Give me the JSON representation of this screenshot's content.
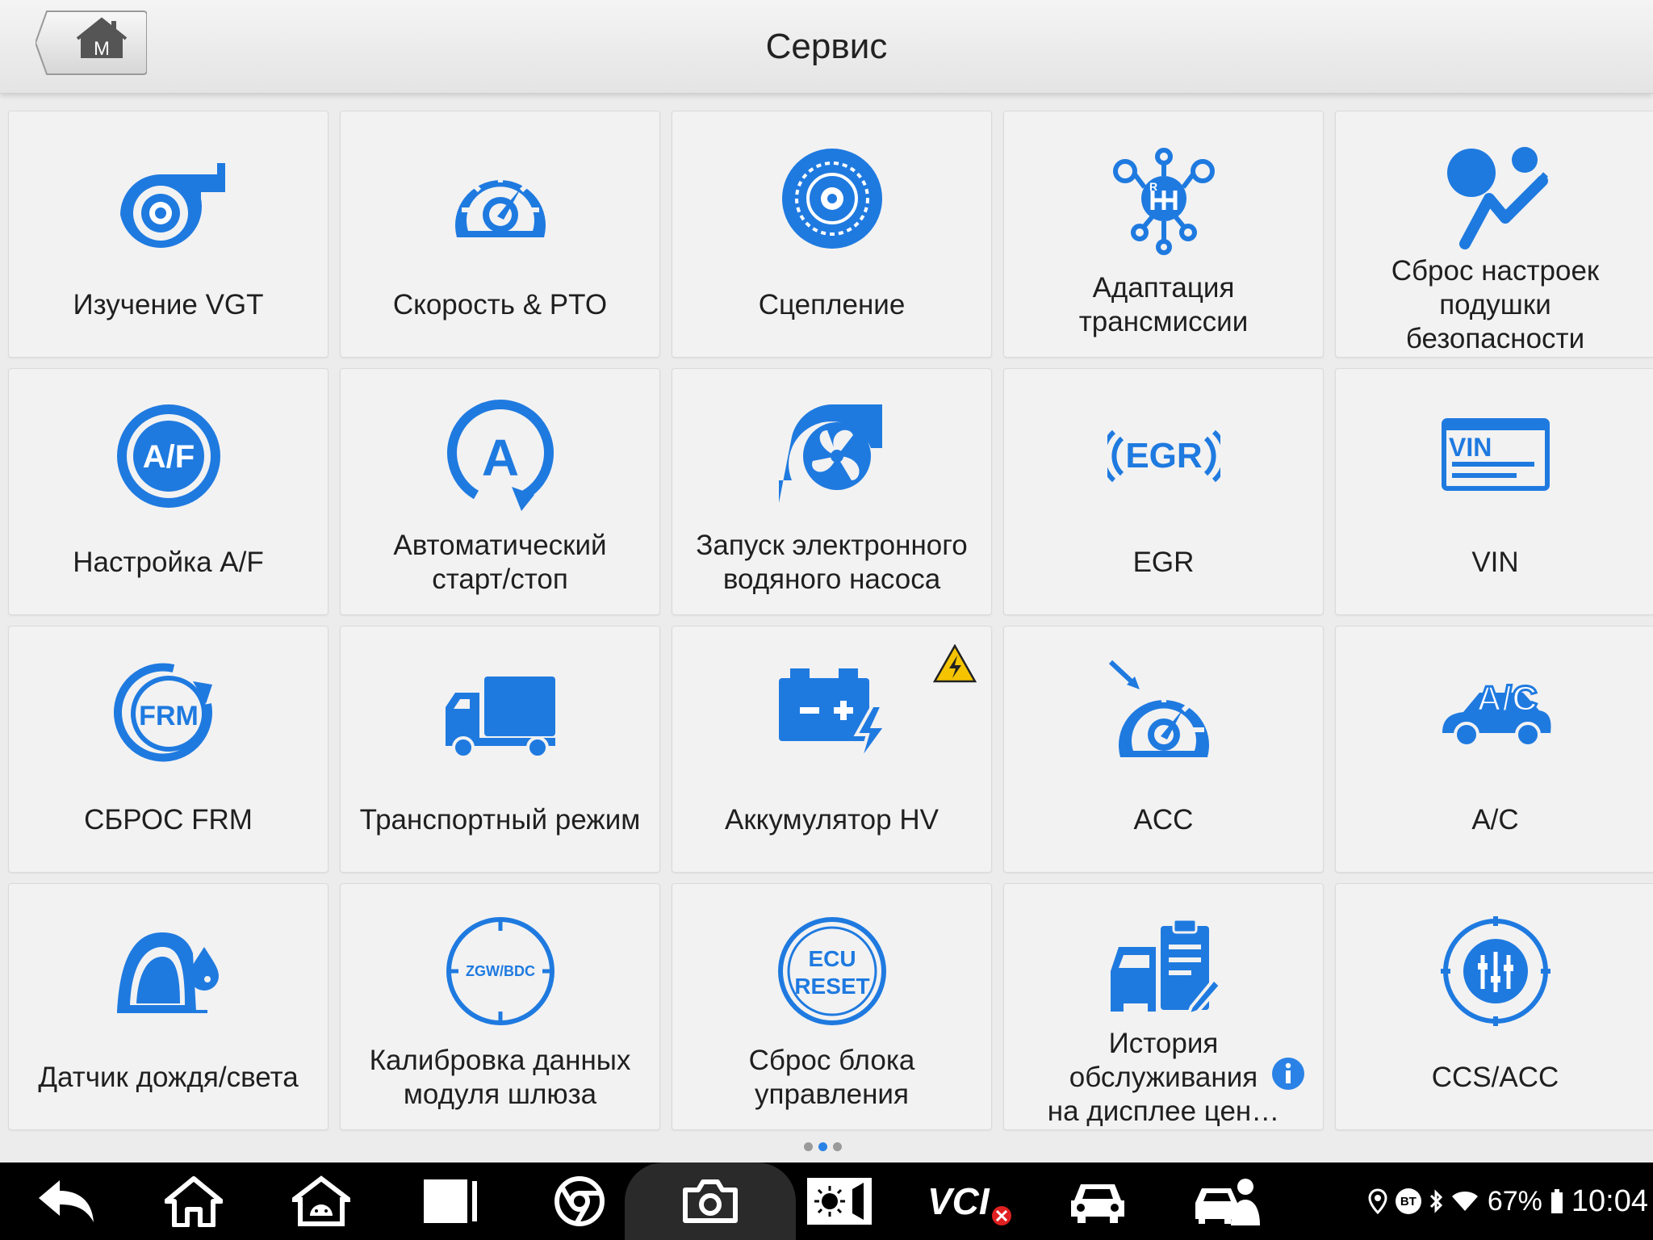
{
  "header": {
    "title": "Сервис",
    "home_letter": "M"
  },
  "colors": {
    "icon_blue": "#1f7ae0",
    "tile_bg": "#f2f2f2",
    "warning": "#f5c400",
    "info": "#2a82e6"
  },
  "tiles": [
    {
      "label_lines": [
        "Изучение VGT"
      ],
      "icon": "turbo-icon"
    },
    {
      "label_lines": [
        "Скорость & PTO"
      ],
      "icon": "speedometer-icon"
    },
    {
      "label_lines": [
        "Сцепление"
      ],
      "icon": "clutch-icon"
    },
    {
      "label_lines": [
        "Адаптация",
        "трансмиссии"
      ],
      "icon": "gearbox-icon"
    },
    {
      "label_lines": [
        "Сброс настроек",
        "подушки",
        "безопасности"
      ],
      "icon": "airbag-icon"
    },
    {
      "label_lines": [
        "Настройка A/F"
      ],
      "icon": "af-icon",
      "icon_text": "A/F"
    },
    {
      "label_lines": [
        "Автоматический",
        "старт/стоп"
      ],
      "icon": "auto-start-stop-icon",
      "icon_text": "A"
    },
    {
      "label_lines": [
        "Запуск электронного",
        "водяного насоса"
      ],
      "icon": "water-pump-icon"
    },
    {
      "label_lines": [
        "EGR"
      ],
      "icon": "egr-icon",
      "icon_text": "EGR"
    },
    {
      "label_lines": [
        "VIN"
      ],
      "icon": "vin-icon",
      "icon_text": "VIN"
    },
    {
      "label_lines": [
        "СБРОС FRM"
      ],
      "icon": "frm-icon",
      "icon_text": "FRM"
    },
    {
      "label_lines": [
        "Транспортный режим"
      ],
      "icon": "truck-icon"
    },
    {
      "label_lines": [
        "Аккумулятор HV"
      ],
      "icon": "battery-icon",
      "badge": "warning"
    },
    {
      "label_lines": [
        "ACC"
      ],
      "icon": "acc-icon"
    },
    {
      "label_lines": [
        "A/C"
      ],
      "icon": "ac-car-icon",
      "icon_text": "A/C"
    },
    {
      "label_lines": [
        "Датчик дождя/света"
      ],
      "icon": "rain-light-sensor-icon"
    },
    {
      "label_lines": [
        "Калибровка данных",
        "модуля шлюза"
      ],
      "icon": "gateway-icon",
      "icon_text": "ZGW/BDC"
    },
    {
      "label_lines": [
        "Сброс блока",
        "управления"
      ],
      "icon": "ecu-reset-icon",
      "icon_text_lines": [
        "ECU",
        "RESET"
      ]
    },
    {
      "label_lines": [
        "История",
        "обслуживания",
        "на дисплее цен…"
      ],
      "icon": "service-history-icon",
      "badge": "info"
    },
    {
      "label_lines": [
        "CCS/ACC"
      ],
      "icon": "ccs-icon"
    }
  ],
  "pager": {
    "count": 3,
    "active": 1
  },
  "navbar": {
    "buttons": [
      "back-icon",
      "home-icon",
      "android-icon",
      "recents-icon",
      "browser-icon",
      "camera-icon",
      "display-settings-icon",
      "vci-icon",
      "car-icon",
      "remote-support-icon"
    ],
    "vci_text": "VCI"
  },
  "status": {
    "bt": "BT",
    "battery": "67%",
    "time": "10:04"
  }
}
